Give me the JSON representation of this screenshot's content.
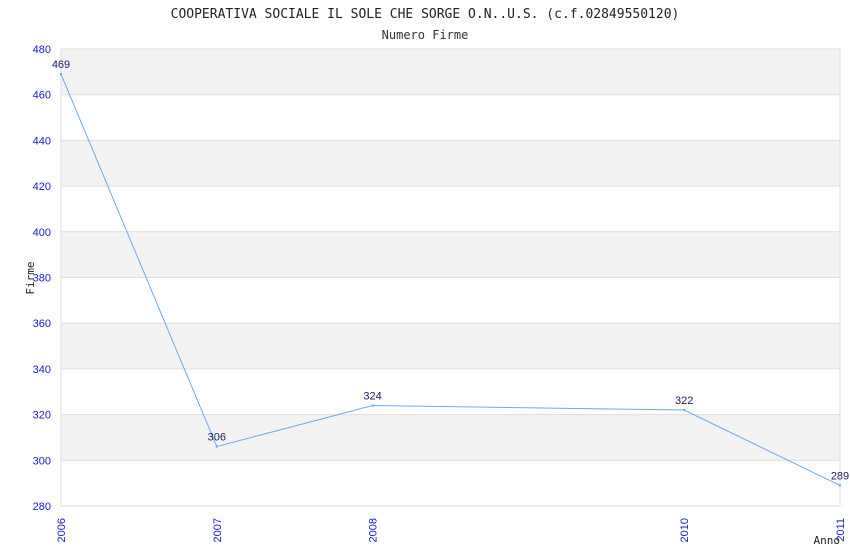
{
  "chart_data": {
    "type": "line",
    "title": "COOPERATIVA SOCIALE IL SOLE CHE SORGE O.N..U.S. (c.f.02849550120)",
    "subtitle": "Numero Firme",
    "xlabel": "Anno",
    "ylabel": "Firme",
    "x": [
      "2006",
      "2007",
      "2008",
      "2010",
      "2011"
    ],
    "y_ticks": [
      "280",
      "300",
      "320",
      "340",
      "360",
      "380",
      "400",
      "420",
      "440",
      "460",
      "480"
    ],
    "ylim": [
      280,
      480
    ],
    "grid": true,
    "series": [
      {
        "values": [
          469,
          306,
          324,
          322,
          289
        ],
        "labels": [
          "469",
          "306",
          "324",
          "322",
          "289"
        ]
      }
    ],
    "colors": {
      "line": "#6aaaee",
      "band": "#f3f3f3",
      "grid": "#dddddd",
      "tick_text": "#1a1acc",
      "data_label": "#1a1a66"
    }
  }
}
